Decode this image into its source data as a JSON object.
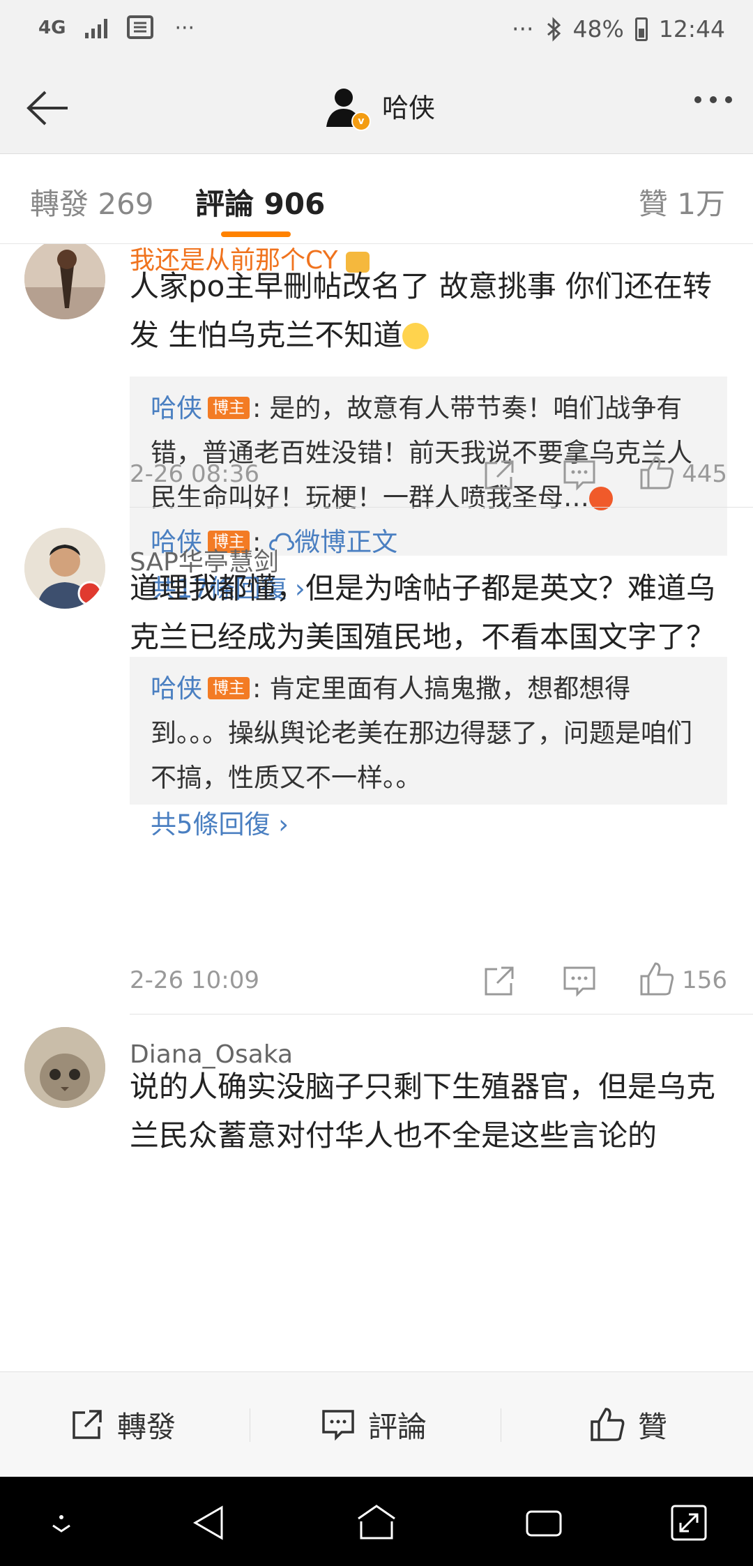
{
  "status_bar": {
    "network": "4G",
    "battery": "48%",
    "time": "12:44",
    "dots": "···"
  },
  "header": {
    "title": "哈侠"
  },
  "tabs": [
    {
      "label": "轉發 269"
    },
    {
      "label": "評論 906"
    },
    {
      "label": "贊 1万"
    }
  ],
  "comments": [
    {
      "author": "我还是从前那个CY",
      "text": "人家po主早刪帖改名了 故意挑事 你们还在转发 生怕乌克兰不知道",
      "replies": [
        {
          "author": "哈侠",
          "tag": "博主",
          "text": ": 是的，故意有人带节奏！咱们战争有错，普通老百姓没错！前天我说不要拿乌克兰人民生命叫好！玩梗！一群人喷我圣母…"
        },
        {
          "author": "哈侠",
          "tag": "博主",
          "sep": ":",
          "link": "微博正文"
        }
      ],
      "more_replies": "共17條回復 ›",
      "time": "2-26 08:36",
      "likes": "445"
    },
    {
      "author": "SAP华亭慧剑",
      "text": "道理我都懂，但是为啥帖子都是英文？难道乌克兰已经成为美国殖民地，不看本国文字了？",
      "replies": [
        {
          "author": "哈侠",
          "tag": "博主",
          "text": ": 肯定里面有人搞鬼撒，想都想得到。。。操纵舆论老美在那边得瑟了，问题是咱们不搞，性质又不一样。。"
        }
      ],
      "more_replies": "共5條回復 ›",
      "time": "2-26 10:09",
      "likes": "156"
    },
    {
      "author": "Diana_Osaka",
      "text": "说的人确实没脑子只剩下生殖器官，但是乌克兰民众蓄意对付华人也不全是这些言论的"
    }
  ],
  "action_bar": {
    "repost": "轉發",
    "comment": "評論",
    "like": "贊"
  },
  "colors": {
    "accent": "#ff8200",
    "link": "#4a7fc1",
    "tag": "#f37b24"
  }
}
